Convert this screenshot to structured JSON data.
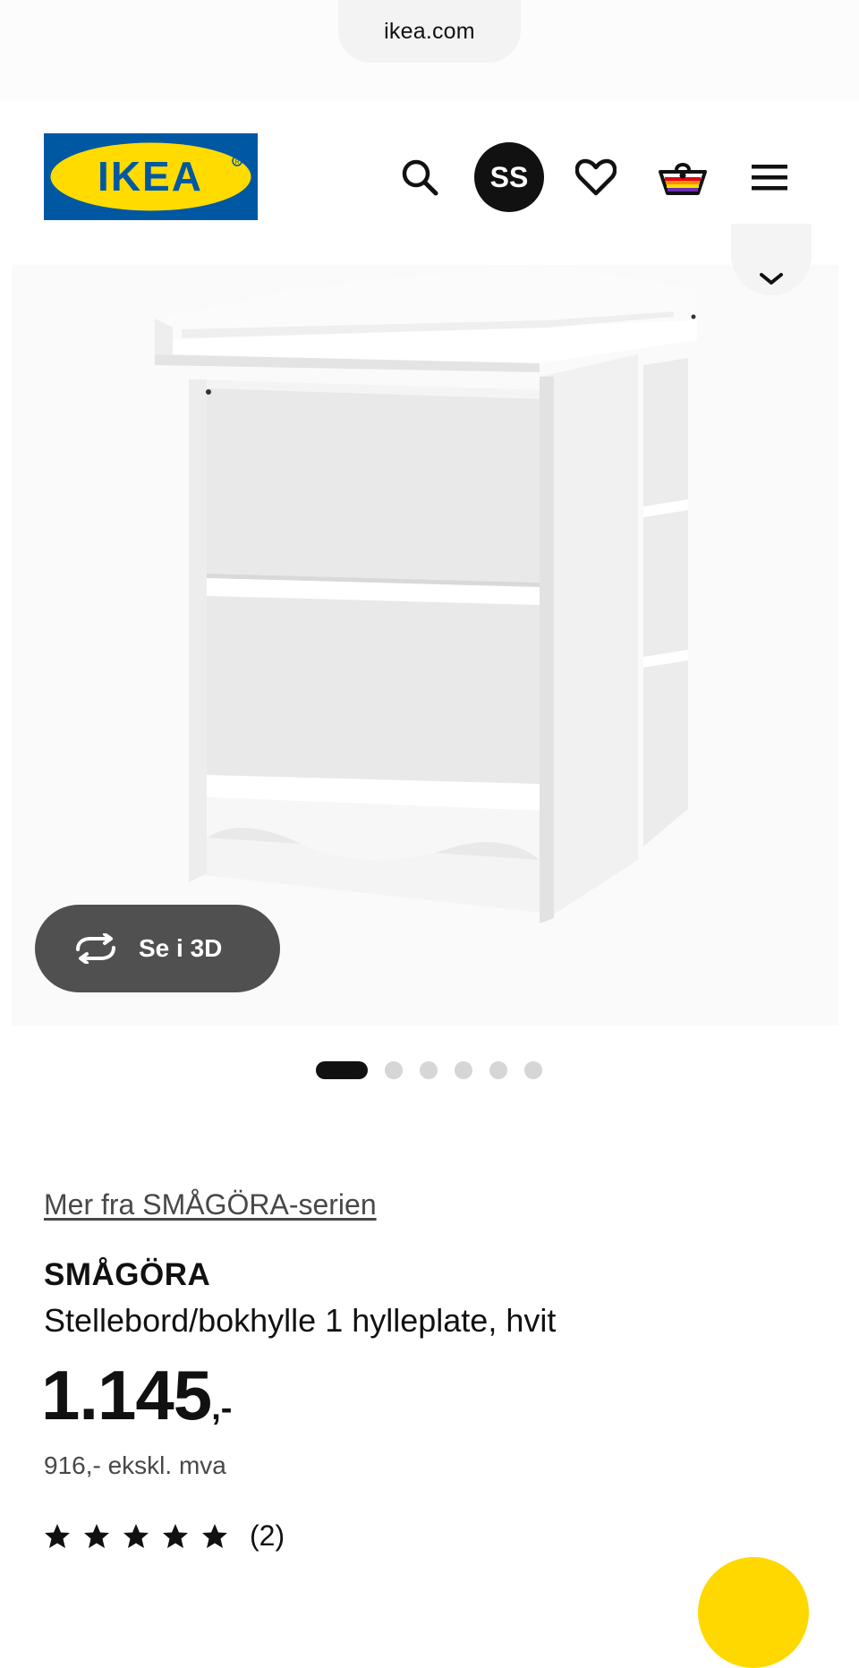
{
  "browser": {
    "url": "ikea.com"
  },
  "header": {
    "logo_text": "IKEA",
    "avatar_initials": "SS",
    "icons": [
      "search-icon",
      "avatar",
      "heart-icon",
      "basket-icon",
      "menu-icon"
    ]
  },
  "gallery": {
    "view_3d_label": "Se i 3D",
    "image_count": 6,
    "active_index": 0
  },
  "product": {
    "series_link": "Mer fra SMÅGÖRA-serien",
    "name": "SMÅGÖRA",
    "description": "Stellebord/bokhylle 1 hylleplate, hvit",
    "price_main": "1.145",
    "price_suffix": ",-",
    "price_ex_vat": "916,- ekskl. mva",
    "rating_stars": 5,
    "rating_count": "(2)"
  },
  "colors": {
    "ikea_blue": "#0058a3",
    "ikea_yellow": "#ffdb00",
    "button_dark": "#505050"
  }
}
